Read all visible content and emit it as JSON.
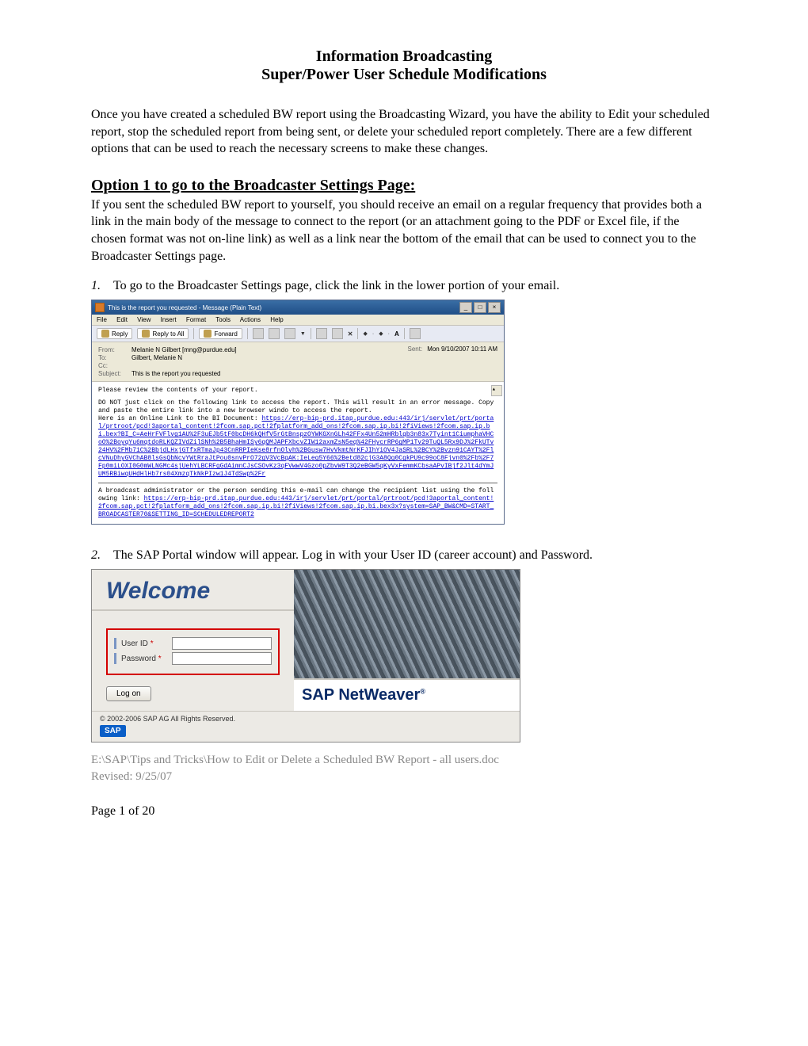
{
  "titles": {
    "t1": "Information Broadcasting",
    "t2": "Super/Power User Schedule Modifications"
  },
  "intro": "Once you have created a scheduled BW report using the Broadcasting Wizard, you have the ability to Edit your scheduled report, stop the scheduled report from being sent, or delete your scheduled report completely.  There are a few different options that can be used to reach the necessary screens to make these changes.",
  "section1": {
    "heading": "Option 1 to go to the Broadcaster Settings Page:",
    "body": "If you sent the scheduled BW report to yourself, you should receive an email on a regular frequency that provides both a link in the main body of the message to connect to the report (or an attachment going to the PDF or Excel file, if the chosen format was not on-line link) as well as a link near the bottom of the email that can be used to connect you to the Broadcaster Settings page."
  },
  "steps": {
    "s1_num": "1.",
    "s1_text": "To go to the Broadcaster Settings page, click the link in the lower portion of your email.",
    "s2_num": "2.",
    "s2_text": "The SAP Portal window will appear.  Log in with your User ID (career account) and Password."
  },
  "email": {
    "title": "This is the report you requested - Message (Plain Text)",
    "win_min": "_",
    "win_max": "□",
    "win_close": "×",
    "menu": {
      "file": "File",
      "edit": "Edit",
      "view": "View",
      "insert": "Insert",
      "format": "Format",
      "tools": "Tools",
      "actions": "Actions",
      "help": "Help"
    },
    "toolbar": {
      "reply": "Reply",
      "reply_all": "Reply to All",
      "forward": "Forward"
    },
    "headers": {
      "from_lbl": "From:",
      "from_val": "Melanie N Gilbert [mng@purdue.edu]",
      "to_lbl": "To:",
      "to_val": "Gilbert, Melanie N",
      "cc_lbl": "Cc:",
      "cc_val": "",
      "subj_lbl": "Subject:",
      "subj_val": "This is the report you requested",
      "sent_lbl": "Sent:",
      "sent_val": "Mon 9/10/2007 10:11 AM"
    },
    "body": {
      "l1": "Please review the contents of your report.",
      "l2a": "DO NOT just click on the following link to access the report.  This will result in an error message.   Copy and paste the entire link into a new browser windo to access the report.",
      "l3": "Here is an Online Link to the BI Document: ",
      "link1": "https://erp-bip-prd.itap.purdue.edu:443/irj/servlet/prt/portal/prtroot/pcd!3aportal_content!2fcom.sap.pct!2fplatform_add_ons!2fcom.sap.ip.bi!2fiViews!2fcom.sap.ip.bi.bex?BI_C=AeHrFVFlvg1AU%2F3uEJb5tF0bcDH6kQHfV5rGtBnspzOYWKGXnGLh42FFx4Un52mHRblqb3n83x7Tyint1CiumphaVHCoO%2BoyqYu6mqtdoRLKQZIVdZilSNh%2B5BhaHmISy6qQMJAPFXbcvZIW12axmZsN5eq%42FHycrRP6gMP1Tv29TuQL5Rx9DJ%2FkUTv24HV%2FMb71C%2BbjdLHxjGTfxRTmaJp43CnRRPIeKse8rfnOlvh%2BGusw7HvVkmtNrKFJIhYiOV4JaSRL%2BCY%2Bvzn91CAYT%2FlcVNuDhyGVChAB8lsGsQbNcvYWtRraJtPou0snvPrO72gV3VcBqAK:IeLeg5Y66%2Betd82cjG3A8Qg0CgkPU9c99oC8Fjvn0%2Fb%2F7Fp0miLOXI0G0mWLNGMc4sjUehYLBCRFgGdAimnCJsCSOvKz3qFVwwV4Gzo0pZbvW9T3Q2eBGW5qKyVxFemmKCbsaAPvIBjf2Jlt4dYmJUM5RBiwqUHdHlHb7rs04XmzqTkNkPIzw1J4TdSwp%2Fr",
      "l4": "A broadcast administrator or the person sending this e-mail can change the recipient list using the following link: ",
      "link2": "https://erp-bip-prd.itap.purdue.edu:443/irj/servlet/prt/portal/prtroot/pcd!3aportal_content!2fcom.sap.pct!2fplatform_add_ons!2fcom.sap.ip.bi!2fiViews!2fcom.sap.ip.bi.bex3x?system=SAP_BW&CMD=START_BROADCASTER70&SETTING_ID=SCHEDULEDREPORT2"
    }
  },
  "sap": {
    "welcome": "Welcome",
    "user_label": "User ID",
    "password_label": "Password",
    "star": "*",
    "logon": "Log on",
    "netweaver": "SAP NetWeaver",
    "reg": "®",
    "copyright": "© 2002-2006 SAP AG All Rights Reserved.",
    "logo": "SAP"
  },
  "footer": {
    "path": "E:\\SAP\\Tips and Tricks\\How to Edit or Delete a Scheduled BW Report - all users.doc",
    "revised": "Revised: 9/25/07",
    "page": "Page 1 of 20"
  }
}
